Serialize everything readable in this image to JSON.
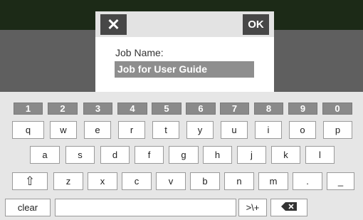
{
  "dialog": {
    "close_icon": "close-x-icon",
    "close_glyph": "✕",
    "ok_label": "OK",
    "field_label": "Job Name:",
    "field_value": "Job for User Guide"
  },
  "keyboard": {
    "numbers": [
      "1",
      "2",
      "3",
      "4",
      "5",
      "6",
      "7",
      "8",
      "9",
      "0"
    ],
    "row1": [
      "q",
      "w",
      "e",
      "r",
      "t",
      "y",
      "u",
      "i",
      "o",
      "p"
    ],
    "row2": [
      "a",
      "s",
      "d",
      "f",
      "g",
      "h",
      "j",
      "k",
      "l"
    ],
    "row3": [
      "z",
      "x",
      "c",
      "v",
      "b",
      "n",
      "m",
      ".",
      "_"
    ],
    "shift_icon": "shift-up-arrow-icon",
    "shift_glyph": "⇧",
    "clear_label": "clear",
    "symbols_label": ">\\+",
    "backspace_icon": "backspace-icon"
  }
}
